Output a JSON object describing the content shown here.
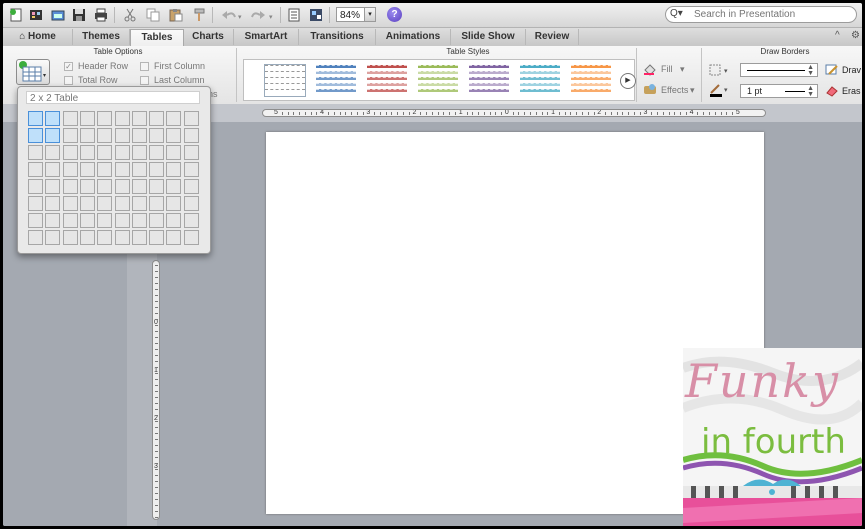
{
  "toolbar": {
    "zoom_value": "84%",
    "help_glyph": "?",
    "search_placeholder": "Search in Presentation",
    "icons": [
      "new-icon",
      "gallery-icon",
      "open-icon",
      "save-icon",
      "print-icon",
      "cut-icon",
      "copy-icon",
      "paste-icon",
      "format-painter-icon",
      "undo-icon",
      "redo-icon",
      "show-formatting-icon",
      "toolbox-icon",
      "zoom-icon",
      "help-icon"
    ]
  },
  "tabs": {
    "home": "Home",
    "themes": "Themes",
    "tables": "Tables",
    "charts": "Charts",
    "smartart": "SmartArt",
    "transitions": "Transitions",
    "animations": "Animations",
    "slideshow": "Slide Show",
    "review": "Review"
  },
  "ribbon": {
    "table_options": {
      "title": "Table Options",
      "header_row": "Header Row",
      "total_row": "Total Row",
      "first_column": "First Column",
      "last_column": "Last Column",
      "banded_partial": "ns"
    },
    "table_styles": {
      "title": "Table Styles",
      "fill_label": "Fill",
      "effects_label": "Effects",
      "colors": [
        "#ffffff",
        "#4f81bd",
        "#c0504d",
        "#9bbb59",
        "#8064a2",
        "#4bacc6",
        "#f79646"
      ]
    },
    "draw_borders": {
      "title": "Draw Borders",
      "weight_value": "1 pt",
      "draw_label": "Drav",
      "erase_label": "Eras"
    }
  },
  "ruler_h": [
    "5",
    "4",
    "3",
    "2",
    "1",
    "0",
    "1",
    "2",
    "3",
    "4",
    "5"
  ],
  "ruler_v": [
    "0",
    "1",
    "2",
    "3"
  ],
  "table_popup": {
    "label": "2 x 2 Table",
    "cols": 10,
    "rows": 8,
    "selected_cols": 2,
    "selected_rows": 2
  },
  "watermark": {
    "title": "Funky",
    "subtitle": "in fourth"
  }
}
